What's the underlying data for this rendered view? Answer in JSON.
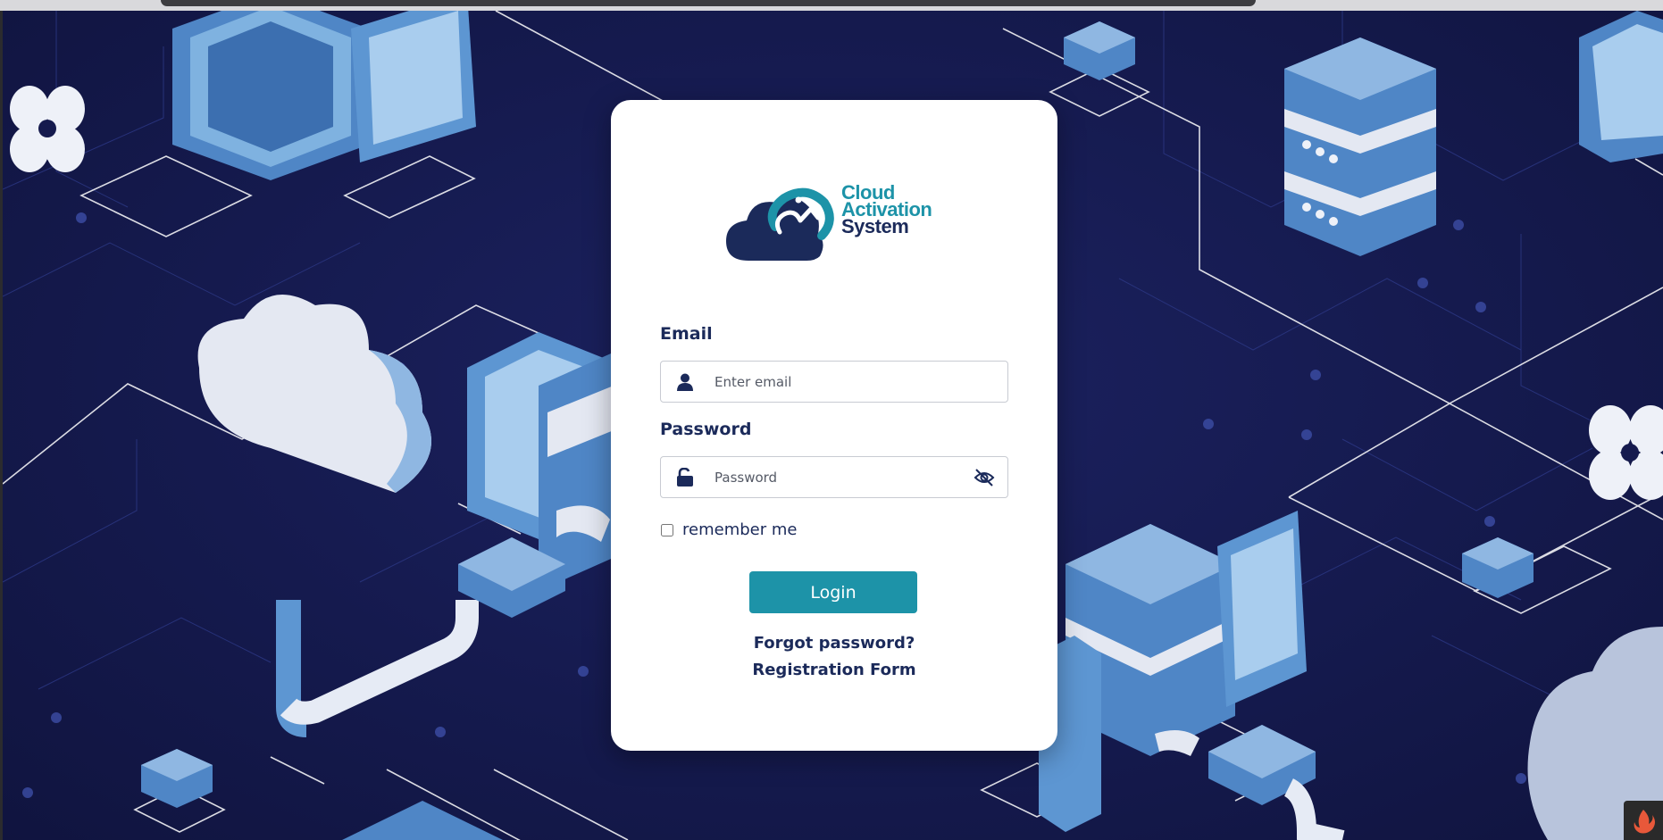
{
  "app": {
    "logo_text": [
      "Cloud",
      "Activation",
      "System"
    ]
  },
  "form": {
    "email_label": "Email",
    "email_placeholder": "Enter email",
    "email_value": "",
    "password_label": "Password",
    "password_placeholder": "Password",
    "password_value": "",
    "remember_label": "remember me",
    "remember_checked": false,
    "login_label": "Login",
    "forgot_label": "Forgot password?",
    "register_label": "Registration Form"
  },
  "icons": {
    "email_field": "user-icon",
    "password_field": "unlock-icon",
    "password_toggle": "eye-slash-icon",
    "corner": "flame-icon"
  },
  "colors": {
    "accent": "#1d93a8",
    "navy": "#1b2a5a",
    "background": "#151a4e",
    "card": "#ffffff"
  }
}
